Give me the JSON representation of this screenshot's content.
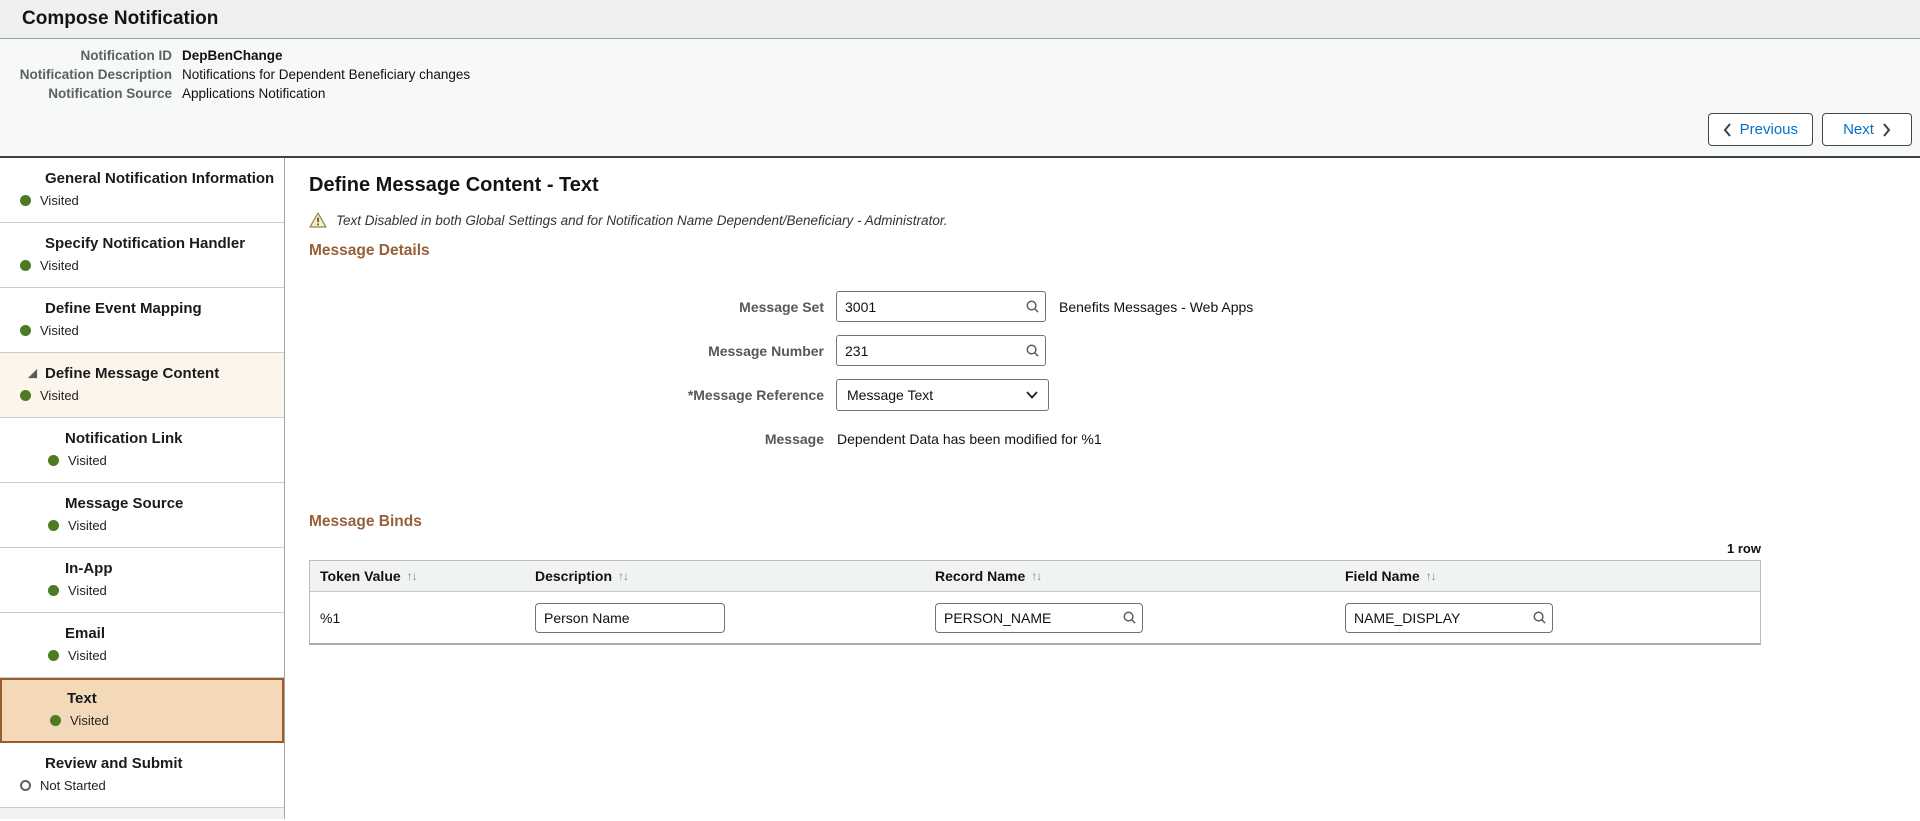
{
  "page": {
    "title": "Compose Notification"
  },
  "header": {
    "fields": [
      {
        "label": "Notification ID",
        "value": "DepBenChange"
      },
      {
        "label": "Notification Description",
        "value": "Notifications for Dependent Beneficiary changes"
      },
      {
        "label": "Notification Source",
        "value": "Applications Notification"
      }
    ],
    "prev_label": "Previous",
    "next_label": "Next"
  },
  "sidebar": {
    "items": [
      {
        "label": "General Notification Information",
        "status": "Visited"
      },
      {
        "label": "Specify Notification Handler",
        "status": "Visited"
      },
      {
        "label": "Define Event Mapping",
        "status": "Visited"
      },
      {
        "label": "Define Message Content",
        "status": "Visited"
      },
      {
        "label": "Notification Link",
        "status": "Visited"
      },
      {
        "label": "Message Source",
        "status": "Visited"
      },
      {
        "label": "In-App",
        "status": "Visited"
      },
      {
        "label": "Email",
        "status": "Visited"
      },
      {
        "label": "Text",
        "status": "Visited"
      },
      {
        "label": "Review and Submit",
        "status": "Not Started"
      }
    ]
  },
  "main": {
    "title": "Define Message Content - Text",
    "warning": "Text Disabled in both Global Settings and for Notification Name Dependent/Beneficiary - Administrator.",
    "section_details": "Message Details",
    "section_binds": "Message Binds",
    "fields": {
      "message_set": {
        "label": "Message Set",
        "value": "3001",
        "description": "Benefits Messages - Web Apps"
      },
      "message_number": {
        "label": "Message Number",
        "value": "231"
      },
      "message_reference": {
        "label": "*Message Reference",
        "value": "Message Text"
      },
      "message": {
        "label": "Message",
        "value": "Dependent Data has been modified for %1"
      }
    },
    "binds": {
      "row_count": "1 row",
      "sort_glyph": "↑↓",
      "columns": [
        "Token Value",
        "Description",
        "Record Name",
        "Field Name"
      ],
      "rows": [
        {
          "token": "%1",
          "description": "Person Name",
          "record": "PERSON_NAME",
          "field": "NAME_DISPLAY"
        }
      ]
    }
  },
  "icons": {
    "search": "magnifier",
    "warning": "yellow-triangle-exclamation",
    "expanded": "filled-corner-triangle",
    "chevron_left": "angle-left",
    "chevron_right": "angle-right",
    "chevron_down": "angle-down"
  },
  "colors": {
    "accent_brown": "#96603a",
    "selected_bg": "#f3d9b7",
    "selected_border": "#9a5b2d",
    "visited_green": "#4c7b23",
    "link_blue": "#0571c9",
    "table_header_bg": "#f0f2f3"
  }
}
